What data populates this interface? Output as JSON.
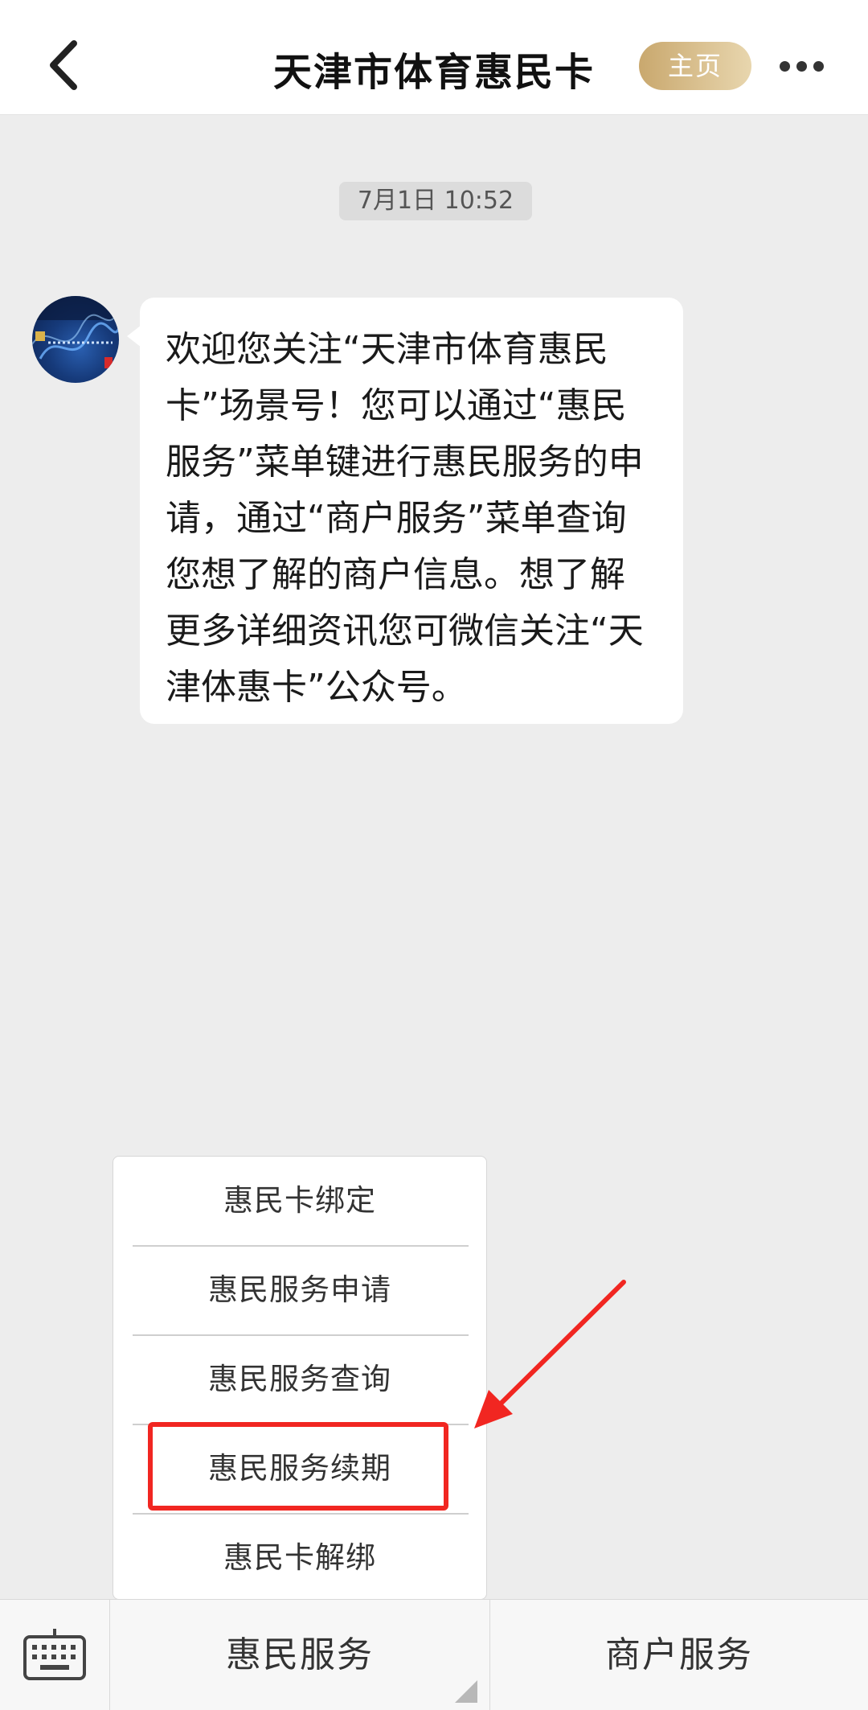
{
  "header": {
    "title": "天津市体育惠民卡",
    "home_label": "主页",
    "back_icon": "chevron-left-icon",
    "more_icon": "more-dots-icon"
  },
  "chat": {
    "timestamp": "7月1日 10:52",
    "message": "欢迎您关注“天津市体育惠民卡”场景号！您可以通过“惠民服务”菜单键进行惠民服务的申请，通过“商户服务”菜单查询您想了解的商户信息。想了解更多详细资讯您可微信关注“天津体惠卡”公众号。"
  },
  "submenu": {
    "items": [
      {
        "label": "惠民卡绑定"
      },
      {
        "label": "惠民服务申请"
      },
      {
        "label": "惠民服务查询"
      },
      {
        "label": "惠民服务续期"
      },
      {
        "label": "惠民卡解绑"
      }
    ],
    "highlighted_index": 3
  },
  "bottom_bar": {
    "keyboard_icon": "keyboard-icon",
    "tabs": [
      {
        "label": "惠民服务"
      },
      {
        "label": "商户服务"
      }
    ]
  },
  "colors": {
    "accent_gold": "#c9a86e",
    "highlight_red": "#f12621",
    "background": "#ededed"
  }
}
